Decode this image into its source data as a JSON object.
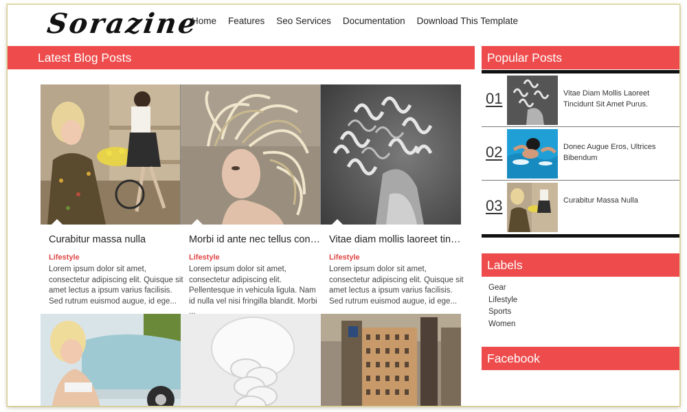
{
  "header": {
    "logo": "Sorazine",
    "nav": [
      "Home",
      "Features",
      "Seo Services",
      "Documentation",
      "Download This Template"
    ]
  },
  "main": {
    "section_title": "Latest Blog Posts",
    "posts": [
      {
        "title": "Curabitur massa nulla",
        "label": "Lifestyle",
        "snippet": "Lorem ipsum dolor sit amet, consectetur adipiscing elit. Quisque sit amet lectus a ipsum varius facilisis. Sed rutrum euismod augue, id ege..."
      },
      {
        "title": "Morbi id ante nec tellus conval...",
        "label": "Lifestyle",
        "snippet": "Lorem ipsum dolor sit amet, consectetur adipiscing elit. Pellentesque in vehicula ligula. Nam id nulla vel nisi fringilla blandit. Morbi ..."
      },
      {
        "title": "Vitae diam mollis laoreet tinci...",
        "label": "Lifestyle",
        "snippet": "Lorem ipsum dolor sit amet, consectetur adipiscing elit. Quisque sit amet lectus a ipsum varius facilisis. Sed rutrum euismod augue, id ege..."
      }
    ]
  },
  "sidebar": {
    "popular_title": "Popular Posts",
    "popular": [
      {
        "num": "01",
        "text": "Vitae Diam Mollis Laoreet Tincidunt Sit Amet Purus."
      },
      {
        "num": "02",
        "text": "Donec Augue Eros, Ultrices Bibendum"
      },
      {
        "num": "03",
        "text": "Curabitur Massa Nulla"
      }
    ],
    "labels_title": "Labels",
    "labels": [
      "Gear",
      "Lifestyle",
      "Sports",
      "Women"
    ],
    "facebook_title": "Facebook"
  },
  "colors": {
    "accent": "#ee4c4c",
    "label_red": "#e04545"
  }
}
